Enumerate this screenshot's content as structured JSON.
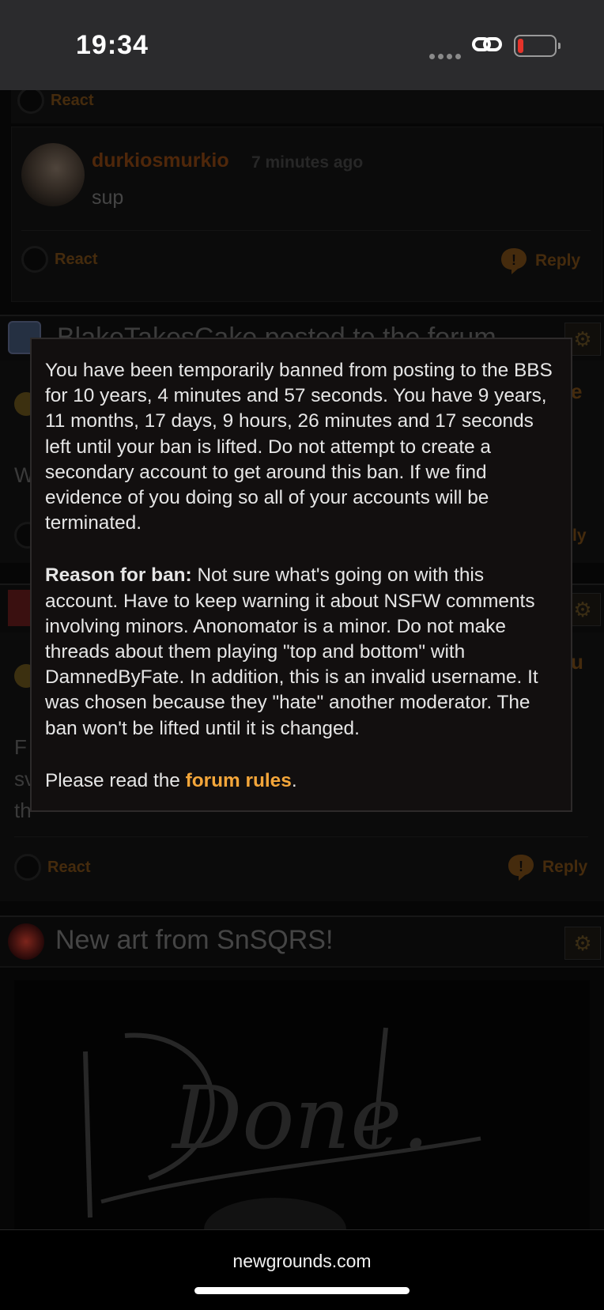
{
  "status_bar": {
    "time": "19:34"
  },
  "feed": {
    "top_react_label": "React",
    "comment": {
      "username": "durkiosmurkio",
      "time_ago": "7 minutes ago",
      "text": "sup",
      "react_label": "React",
      "reply_label": "Reply"
    },
    "post1": {
      "title": "BlakeTakesCake posted to the forum",
      "partial_letter_right": "e",
      "partial_body": "W",
      "partial_reply": "ly"
    },
    "post2": {
      "partial_right": "u",
      "partial_body_lines": [
        "F",
        "sv",
        "th"
      ],
      "react_label": "React",
      "reply_label": "Reply"
    },
    "post3": {
      "title": "New art from SnSQRS!",
      "art_text": "Done."
    }
  },
  "ban_modal": {
    "message": "You have been temporarily banned from posting to the BBS for 10 years, 4 minutes and 57 seconds. You have 9 years, 11 months, 17 days, 9 hours, 26 minutes and 17 seconds left until your ban is lifted. Do not attempt to create a secondary account to get around this ban. If we find evidence of you doing so all of your accounts will be terminated.",
    "reason_label": "Reason for ban:",
    "reason_text": " Not sure what's going on with this account. Have to keep warning it about NSFW comments involving minors. Anonomator is a minor. Do not make threads about them playing \"top and bottom\" with DamnedByFate. In addition, this is an invalid username. It was chosen because they \"hate\" another moderator. The ban won't be lifted until it is changed.",
    "rules_prefix": "Please read the ",
    "rules_link": "forum rules",
    "rules_suffix": "."
  },
  "browser": {
    "domain": "newgrounds.com"
  },
  "colors": {
    "accent": "#f4a63a",
    "username": "#7a3d10",
    "muted_orange": "#6b4314"
  }
}
